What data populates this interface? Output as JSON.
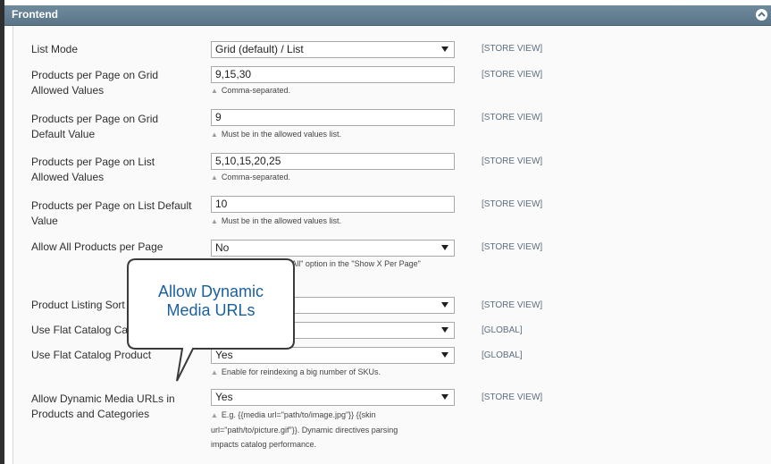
{
  "section": {
    "title": "Frontend"
  },
  "rows": [
    {
      "label": "List Mode",
      "kind": "select",
      "value": "Grid (default) / List",
      "scope": "[STORE VIEW]"
    },
    {
      "label_line1": "Products per Page on Grid",
      "label_line2": "Allowed Values",
      "kind": "input",
      "value": "9,15,30",
      "note": "Comma-separated.",
      "scope": "[STORE VIEW]"
    },
    {
      "label_line1": "Products per Page on Grid",
      "label_line2": "Default Value",
      "kind": "input",
      "value": "9",
      "note": "Must be in the allowed values list.",
      "scope": "[STORE VIEW]"
    },
    {
      "label_line1": "Products per Page on List",
      "label_line2": "Allowed Values",
      "kind": "input",
      "value": "5,10,15,20,25",
      "note": "Comma-separated.",
      "scope": "[STORE VIEW]"
    },
    {
      "label_line1": "Products per Page on List Default",
      "label_line2": "Value",
      "kind": "input",
      "value": "10",
      "note": "Must be in the allowed values list.",
      "scope": "[STORE VIEW]"
    },
    {
      "label": "Allow All Products per Page",
      "kind": "select",
      "value": "No",
      "note_visible": "\"All\" option in the \"Show X Per Page\"",
      "scope": "[STORE VIEW]"
    },
    {
      "label": "Product Listing Sort",
      "kind": "select",
      "value": "",
      "scope": "[STORE VIEW]"
    },
    {
      "label": "Use Flat Catalog Ca",
      "kind": "select",
      "value": "",
      "scope": "[GLOBAL]"
    },
    {
      "label": "Use Flat Catalog Product",
      "kind": "select",
      "value": "Yes",
      "note": "Enable for reindexing a big number of SKUs.",
      "scope": "[GLOBAL]"
    },
    {
      "label_line1": "Allow Dynamic Media URLs in",
      "label_line2": "Products and Categories",
      "kind": "select",
      "value": "Yes",
      "note_line1": "E.g. {{media url=\"path/to/image.jpg\"}} {{skin",
      "note_line2": "url=\"path/to/picture.gif\"}}. Dynamic directives parsing",
      "note_line3": "impacts catalog performance.",
      "scope": "[STORE VIEW]"
    }
  ],
  "callout": {
    "line1": "Allow Dynamic",
    "line2": "Media URLs"
  },
  "colors": {
    "header": "#5b7588",
    "scope_text": "#5d6f80",
    "callout_text": "#1a5f9e"
  }
}
